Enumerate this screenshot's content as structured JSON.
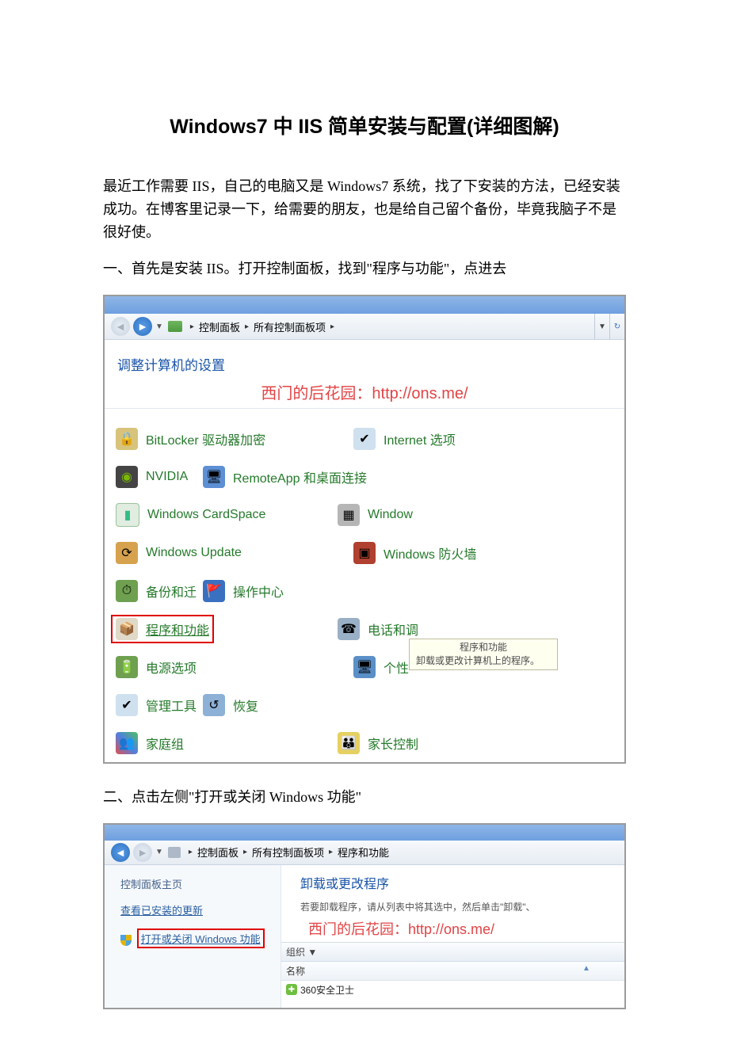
{
  "doc": {
    "title": "Windows7 中 IIS 简单安装与配置(详细图解)",
    "para_intro": "最近工作需要 IIS，自己的电脑又是 Windows7 系统，找了下安装的方法，已经安装成功。在博客里记录一下，给需要的朋友，也是给自己留个备份，毕竟我脑子不是很好使。",
    "step1": "一、首先是安装 IIS。打开控制面板，找到\"程序与功能\"，点进去",
    "step2": "二、点击左侧\"打开或关闭 Windows 功能\""
  },
  "shot1": {
    "breadcrumb": {
      "a": "控制面板",
      "b": "所有控制面板项"
    },
    "heading": "调整计算机的设置",
    "watermark": "西门的后花园：http://ons.me/",
    "items": {
      "bitlocker": "BitLocker 驱动器加密",
      "internet": "Internet 选项",
      "nvidia": "NVIDIA",
      "remoteapp": "RemoteApp 和桌面连接",
      "cardspace": "Windows CardSpace",
      "windows_row2": "Window",
      "winupdate": "Windows Update",
      "firewall": "Windows 防火墙",
      "backup": "备份和迁",
      "actioncenter": "操作中心",
      "programs": "程序和功能",
      "phone": "电话和调",
      "power": "电源选项",
      "personal": "个性",
      "admintools": "管理工具",
      "recovery": "恢复",
      "homegroup": "家庭组",
      "parental": "家长控制"
    },
    "tooltip": {
      "title": "程序和功能",
      "body": "卸载或更改计算机上的程序。"
    }
  },
  "shot2": {
    "breadcrumb": {
      "a": "控制面板",
      "b": "所有控制面板项",
      "c": "程序和功能"
    },
    "side": {
      "home": "控制面板主页",
      "updates": "查看已安装的更新",
      "winfeat": "打开或关闭 Windows 功能"
    },
    "main": {
      "title": "卸载或更改程序",
      "sub": "若要卸载程序，请从列表中将其选中，然后单击\"卸载\"、",
      "watermark": "西门的后花园：http://ons.me/",
      "organize": "组织 ▼",
      "col_name": "名称",
      "row1": "360安全卫士"
    }
  }
}
